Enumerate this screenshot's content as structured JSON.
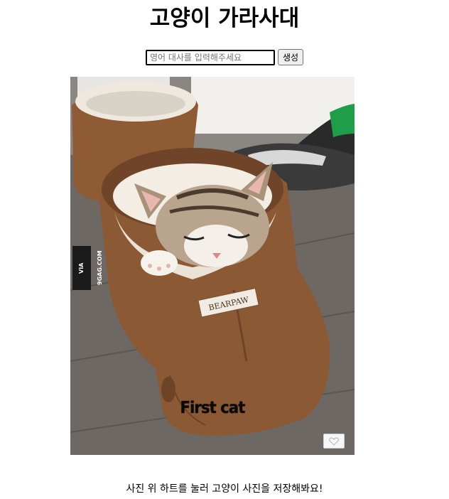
{
  "header": {
    "title": "고양이 가라사대"
  },
  "form": {
    "input_placeholder": "영어 대사를 입력해주세요",
    "input_value": "",
    "submit_label": "생성"
  },
  "photo": {
    "caption": "First cat",
    "watermark": "VIA 9GAG.COM",
    "boot_label": "BEARPAW",
    "like_icon": "heart-outline-icon"
  },
  "footer": {
    "hint": "사진 위 하트를 눌러 고양이 사진을 저장해봐요!"
  },
  "colors": {
    "boot": "#8b5a35",
    "floor": "#6a6560",
    "title_text": "#000000"
  }
}
